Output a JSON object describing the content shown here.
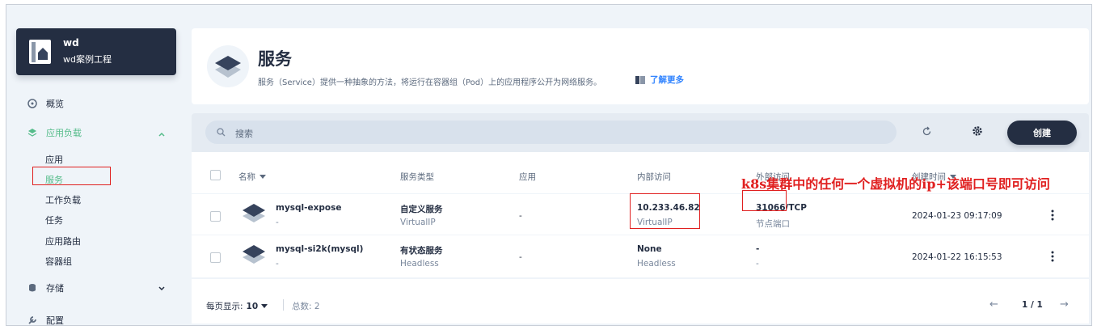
{
  "workspace": {
    "name": "wd",
    "description": "wd案例工程"
  },
  "nav": {
    "overview": "概览",
    "app_workloads": "应用负载",
    "sub_items": [
      "应用",
      "服务",
      "工作负载",
      "任务",
      "应用路由",
      "容器组"
    ],
    "storage": "存储",
    "config": "配置"
  },
  "header": {
    "title": "服务",
    "description": "服务（Service）提供一种抽象的方法，将运行在容器组（Pod）上的应用程序公开为网络服务。",
    "learn_more": "了解更多"
  },
  "toolbar": {
    "search_placeholder": "搜索",
    "create_label": "创建"
  },
  "table": {
    "columns": [
      "名称",
      "服务类型",
      "应用",
      "内部访问",
      "外部访问",
      "创建时间"
    ],
    "rows": [
      {
        "name": "mysql-expose",
        "name_sub": "-",
        "type": "自定义服务",
        "type_sub": "VirtualIP",
        "app": "-",
        "internal": "10.233.46.82",
        "internal_sub": "VirtualIP",
        "external": "31066/TCP",
        "external_sub": "节点端口",
        "created": "2024-01-23 09:17:09"
      },
      {
        "name": "mysql-si2k(mysql)",
        "name_sub": "-",
        "type": "有状态服务",
        "type_sub": "Headless",
        "app": "-",
        "internal": "None",
        "internal_sub": "Headless",
        "external": "-",
        "external_sub": "-",
        "created": "2024-01-22 16:15:53"
      }
    ]
  },
  "footer": {
    "per_page_label": "每页显示:",
    "per_page_value": "10",
    "total": "总数: 2",
    "page": "1 / 1"
  },
  "annotation": "k8s集群中的任何一个虚拟机的ip+该端口号即可访问",
  "colors": {
    "accent": "#55bc8a",
    "dark": "#242e42",
    "link": "#3385ff",
    "annotation": "#e02020"
  }
}
